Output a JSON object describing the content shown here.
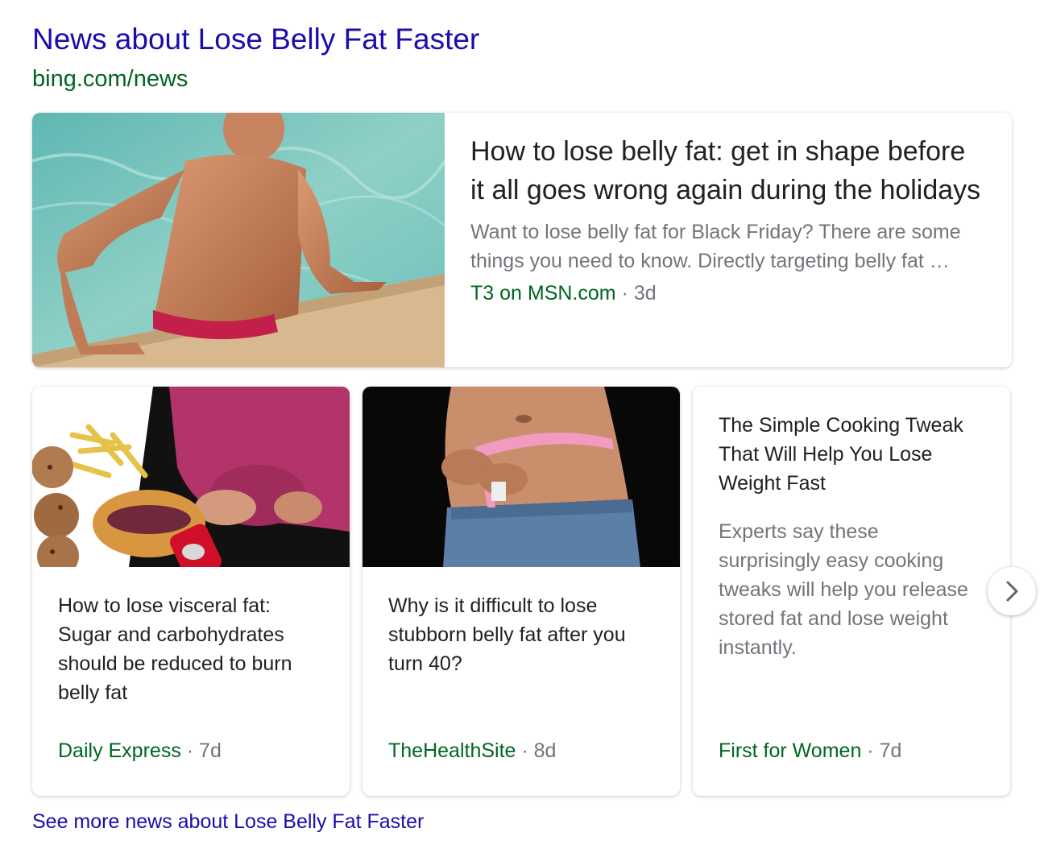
{
  "header": {
    "title": "News about Lose Belly Fat Faster",
    "source_url": "bing.com/news"
  },
  "featured": {
    "headline": "How to lose belly fat: get in shape before it all goes wrong again during the holidays",
    "snippet": "Want to lose belly fat for Black Friday? There are some things you need to know. Directly targeting belly fat …",
    "publisher": "T3 on MSN.com",
    "separator": " · ",
    "age": "3d",
    "image": "man-in-pool-photo"
  },
  "cards": [
    {
      "headline": "How to lose visceral fat: Sugar and carbohydrates should be reduced to burn belly fat",
      "publisher": "Daily Express",
      "separator": " · ",
      "age": "7d",
      "image": "belly-fat-junk-food-photo"
    },
    {
      "headline": "Why is it difficult to lose stubborn belly fat after you turn 40?",
      "publisher": "TheHealthSite",
      "separator": " · ",
      "age": "8d",
      "image": "measuring-tape-waist-photo"
    },
    {
      "headline": "The Simple Cooking Tweak That Will Help You Lose Weight Fast",
      "snippet": "Experts say these surprisingly easy cooking tweaks will help you release stored fat and lose weight instantly.",
      "publisher": "First for Women",
      "separator": " · ",
      "age": "7d"
    }
  ],
  "carousel": {
    "next_icon": "chevron-right-icon"
  },
  "footer": {
    "see_more": "See more news about Lose Belly Fat Faster"
  },
  "colors": {
    "link": "#1a0dab",
    "url_green": "#006621",
    "text": "#202124",
    "muted": "#70757a"
  }
}
